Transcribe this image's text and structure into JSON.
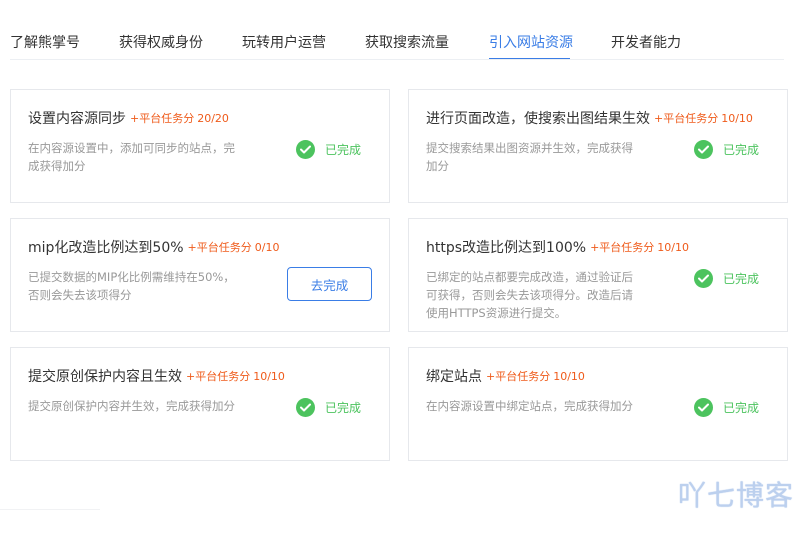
{
  "tabs": [
    {
      "label": "了解熊掌号"
    },
    {
      "label": "获得权威身份"
    },
    {
      "label": "玩转用户运营"
    },
    {
      "label": "获取搜索流量"
    },
    {
      "label": "引入网站资源"
    },
    {
      "label": "开发者能力"
    }
  ],
  "active_tab": "引入网站资源",
  "cards": [
    {
      "title": "设置内容源同步",
      "score_label": "+平台任务分",
      "score_value": "20/20",
      "desc_lines": [
        "在内容源设置中，添加可同步的站点，完",
        "成获得加分"
      ],
      "status": "已完成",
      "status_icon": "check-circle-icon"
    },
    {
      "title": "进行页面改造，使搜索出图结果生效",
      "score_label": "+平台任务分",
      "score_value": "10/10",
      "desc_lines": [
        "提交搜索结果出图资源并生效，完成获得",
        "加分"
      ],
      "status": "已完成",
      "status_icon": "check-circle-icon"
    },
    {
      "title": "mip化改造比例达到50%",
      "score_label": "+平台任务分",
      "score_value": "0/10",
      "desc_lines": [
        "已提交数据的MIP化比例需维持在50%，",
        "否则会失去该项得分"
      ],
      "action": "去完成"
    },
    {
      "title": "https改造比例达到100%",
      "score_label": "+平台任务分",
      "score_value": "10/10",
      "desc_lines": [
        "已绑定的站点都要完成改造，通过验证后",
        "可获得，否则会失去该项得分。改造后请",
        "使用HTTPS资源进行提交。"
      ],
      "status": "已完成",
      "status_icon": "check-circle-icon"
    },
    {
      "title": "提交原创保护内容且生效",
      "score_label": "+平台任务分",
      "score_value": "10/10",
      "desc_lines": [
        "提交原创保护内容并生效，完成获得加分"
      ],
      "status": "已完成",
      "status_icon": "check-circle-icon"
    },
    {
      "title": "绑定站点",
      "score_label": "+平台任务分",
      "score_value": "10/10",
      "desc_lines": [
        "在内容源设置中绑定站点，完成获得加分"
      ],
      "status": "已完成",
      "status_icon": "check-circle-icon"
    }
  ],
  "watermark": "吖七博客",
  "colors": {
    "accent": "#3a7de6",
    "success": "#4cc35e",
    "score": "#ef5b1b",
    "muted": "#999999",
    "border": "#e6e8ec"
  }
}
